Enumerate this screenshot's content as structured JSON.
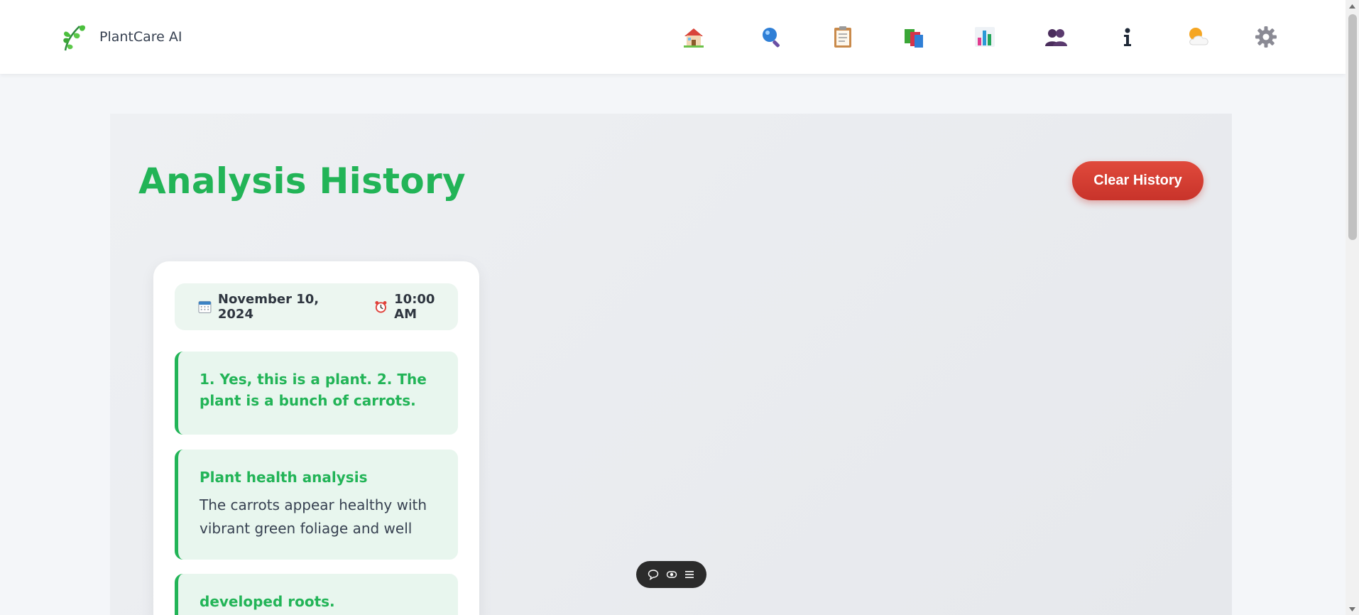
{
  "app": {
    "name": "PlantCare AI",
    "logo_icon": "leaf-sprig-icon"
  },
  "nav": [
    {
      "icon": "home-icon"
    },
    {
      "icon": "magnifier-icon"
    },
    {
      "icon": "clipboard-icon"
    },
    {
      "icon": "books-icon"
    },
    {
      "icon": "bar-chart-icon"
    },
    {
      "icon": "users-icon"
    },
    {
      "icon": "info-icon"
    },
    {
      "icon": "weather-icon"
    },
    {
      "icon": "gear-icon"
    }
  ],
  "page": {
    "title": "Analysis History",
    "clear_button": "Clear History"
  },
  "history": [
    {
      "date": "November 10, 2024",
      "time": "10:00 AM",
      "answer": "1. Yes, this is a plant. 2. The plant is a bunch of carrots.",
      "analysis_heading": "Plant health analysis",
      "analysis_text": "The carrots appear healthy with vibrant green foliage and well",
      "continued_text": "developed roots."
    }
  ],
  "toolbar": {
    "icons": [
      "chat-bubble-icon",
      "eye-toggle-icon",
      "menu-icon"
    ]
  },
  "colors": {
    "accent": "#22b457",
    "danger": "#d13c30",
    "card_tint": "#e8f6ee"
  }
}
